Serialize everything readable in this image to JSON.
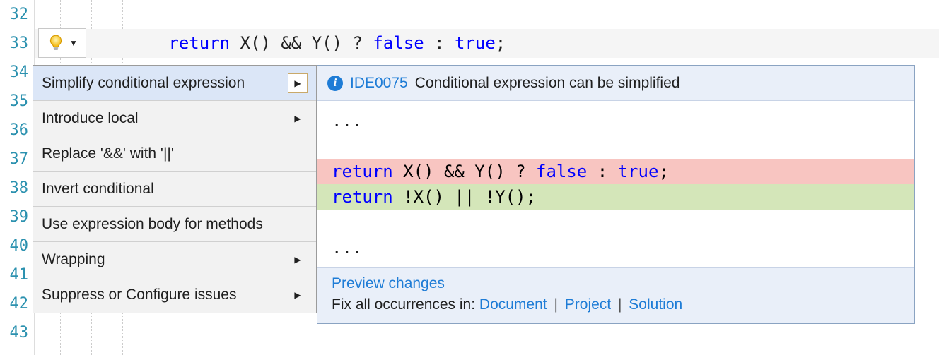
{
  "gutter": {
    "start": 32,
    "end": 43
  },
  "code": {
    "line33_kw": "return",
    "line33_rest": " X() && Y() ? ",
    "line33_false": "false",
    "line33_mid": " : ",
    "line33_true": "true",
    "line33_end": ";"
  },
  "bulb": {
    "aria": "lightbulb-icon"
  },
  "actions": {
    "items": [
      {
        "label": "Simplify conditional expression",
        "submenu": true,
        "selected": true
      },
      {
        "label": "Introduce local",
        "submenu": true,
        "selected": false
      },
      {
        "label": "Replace '&&' with '||'",
        "submenu": false,
        "selected": false
      },
      {
        "label": "Invert conditional",
        "submenu": false,
        "selected": false
      },
      {
        "label": "Use expression body for methods",
        "submenu": false,
        "selected": false
      },
      {
        "label": "Wrapping",
        "submenu": true,
        "selected": false
      },
      {
        "label": "Suppress or Configure issues",
        "submenu": true,
        "selected": false
      }
    ]
  },
  "preview": {
    "diag_id": "IDE0075",
    "diag_msg": "Conditional expression can be simplified",
    "context_top": "...",
    "del_kw": "return",
    "del_rest": " X() && Y() ? ",
    "del_false": "false",
    "del_mid": " : ",
    "del_true": "true",
    "del_end": ";",
    "add_kw": "return",
    "add_rest": " !X() || !Y();",
    "context_bot": "...",
    "preview_changes": "Preview changes",
    "fix_prefix": "Fix all occurrences in: ",
    "fix_document": "Document",
    "fix_project": "Project",
    "fix_solution": "Solution"
  }
}
